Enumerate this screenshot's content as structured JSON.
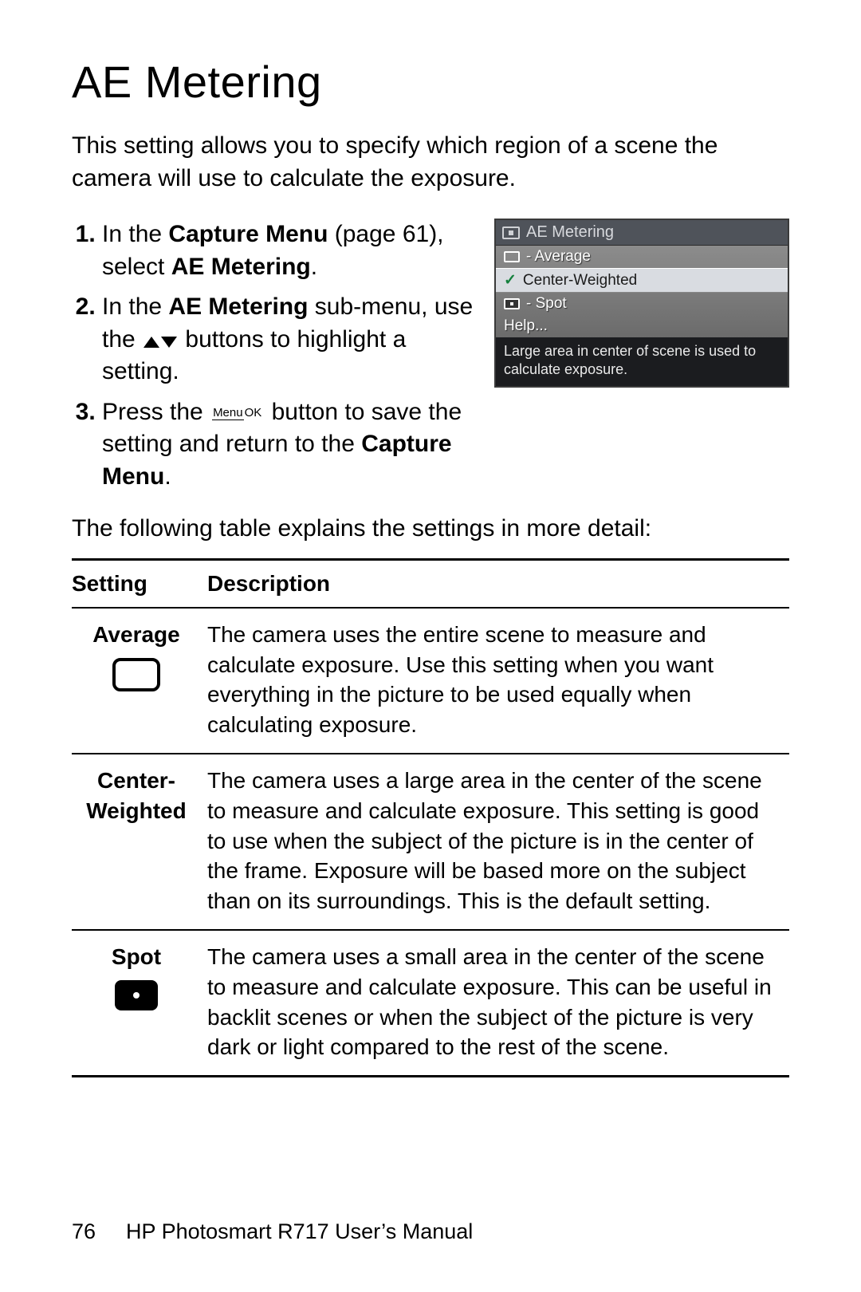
{
  "title": "AE Metering",
  "intro": "This setting allows you to specify which region of a scene the camera will use to calculate the exposure.",
  "steps": {
    "s1_a": "In the ",
    "s1_b": "Capture Menu",
    "s1_c": " (page 61), select ",
    "s1_d": "AE Metering",
    "s1_e": ".",
    "s2_a": "In the ",
    "s2_b": "AE Metering",
    "s2_c": " sub-menu, use the ",
    "s2_d": " buttons to highlight a setting.",
    "s3_a": "Press the ",
    "s3_b": " button to save the setting and return to the ",
    "s3_c": "Capture Menu",
    "s3_d": "."
  },
  "menuok": {
    "top": "Menu",
    "bot": "OK"
  },
  "cam": {
    "header": "AE Metering",
    "items": {
      "avg": "- Average",
      "cw": "Center-Weighted",
      "spot": "- Spot",
      "help": "Help..."
    },
    "hint": "Large area in center of scene is used to calculate exposure."
  },
  "lead2": "The following table explains the settings in more detail:",
  "table": {
    "head": {
      "c1": "Setting",
      "c2": "Description"
    },
    "rows": {
      "r1": {
        "name": "Average",
        "desc": "The camera uses the entire scene to measure and calculate exposure. Use this setting when you want everything in the picture to be used equally when calculating exposure."
      },
      "r2": {
        "name": "Center-Weighted",
        "desc": "The camera uses a large area in the center of the scene to measure and calculate exposure. This setting is good to use when the subject of the picture is in the center of the frame. Exposure will be based more on the subject than on its surroundings. This is the default setting."
      },
      "r3": {
        "name": "Spot",
        "desc": "The camera uses a small area in the center of the scene to measure and calculate exposure. This can be useful in backlit scenes or when the subject of the picture is very dark or light compared to the rest of the scene."
      }
    }
  },
  "footer": {
    "page": "76",
    "book": "HP Photosmart R717 User’s Manual"
  }
}
